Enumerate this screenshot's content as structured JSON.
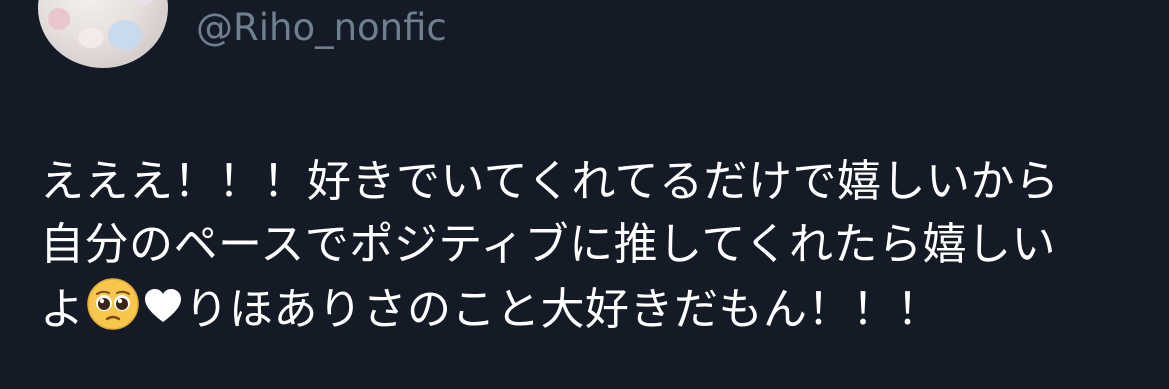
{
  "author": {
    "handle": "@Riho_nonfic"
  },
  "tweet": {
    "line1": "えええ！！！好きでいてくれてるだけで嬉しいから",
    "line2": "自分のペースでポジティブに推してくれたら嬉しい",
    "line3_start": "よ",
    "line3_end": "りほありさのこと大好きだもん！！！"
  },
  "icons": [
    "avatar",
    "pleading-face-icon",
    "heart-icon"
  ]
}
